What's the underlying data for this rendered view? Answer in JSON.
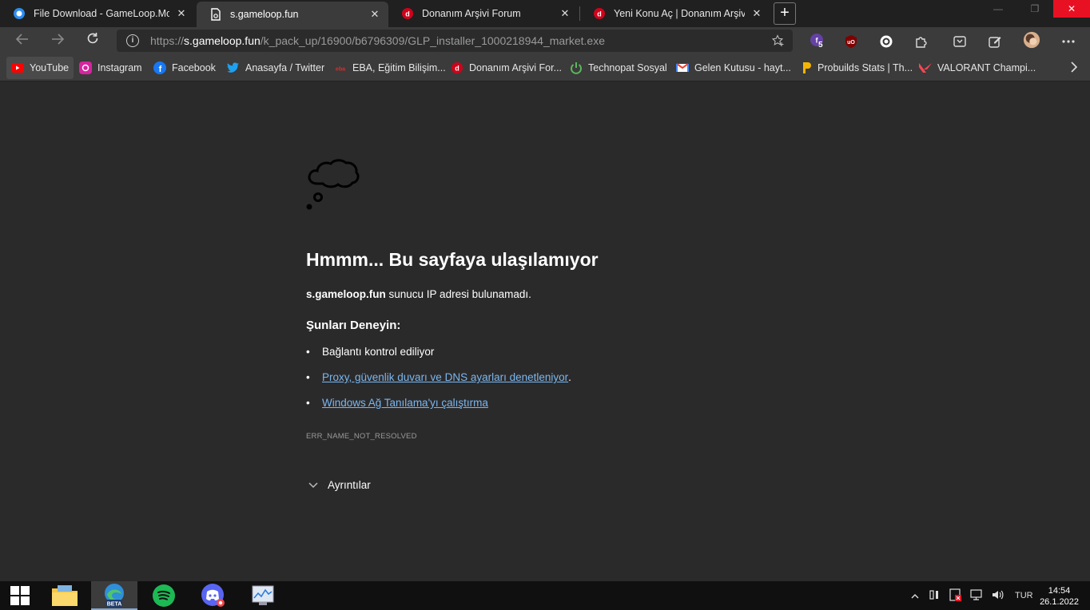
{
  "tabs": [
    {
      "title": "File Download - GameLoop.Mob",
      "icon": "gameloop-icon",
      "active": false
    },
    {
      "title": "s.gameloop.fun",
      "icon": "page-error-icon",
      "active": true
    },
    {
      "title": "Donanım Arşivi Forum",
      "icon": "donanim-arsivi-icon",
      "active": false
    },
    {
      "title": "Yeni Konu Aç | Donanım Arşivi Fo",
      "icon": "donanim-arsivi-icon",
      "active": false
    }
  ],
  "tab_close": "✕",
  "newtab": "+",
  "window_controls": {
    "minimize": "—",
    "maximize": "❐",
    "close": "✕"
  },
  "address": {
    "prefix": "https://",
    "host": "s.gameloop.fun",
    "path": "/k_pack_up/16900/b6796309/GLP_installer_1000218944_market.exe"
  },
  "extensions": {
    "badge_count": "5"
  },
  "bookmarks": [
    {
      "label": "YouTube",
      "icon": "youtube-icon",
      "color": "#ff0000"
    },
    {
      "label": "Instagram",
      "icon": "instagram-icon",
      "color": "#c13584"
    },
    {
      "label": "Facebook",
      "icon": "facebook-icon",
      "color": "#1877f2"
    },
    {
      "label": "Anasayfa / Twitter",
      "icon": "twitter-icon",
      "color": "#1da1f2"
    },
    {
      "label": "EBA, Eğitim Bilişim...",
      "icon": "eba-icon",
      "color": "#d32f2f"
    },
    {
      "label": "Donanım Arşivi For...",
      "icon": "donanim-arsivi-icon",
      "color": "#d0021b"
    },
    {
      "label": "Technopat Sosyal",
      "icon": "technopat-icon",
      "color": "#5cb85c"
    },
    {
      "label": "Gelen Kutusu - hayt...",
      "icon": "gmail-icon",
      "color": "#ea4335"
    },
    {
      "label": "Probuilds Stats | Th...",
      "icon": "probuilds-icon",
      "color": "#f5b400"
    },
    {
      "label": "VALORANT Champi...",
      "icon": "valorant-icon",
      "color": "#ff4655"
    }
  ],
  "error": {
    "title": "Hmmm... Bu sayfaya ulaşılamıyor",
    "host": "s.gameloop.fun",
    "message": " sunucu IP adresi bulunamadı.",
    "try_heading": "Şunları Deneyin:",
    "items": [
      {
        "text": "Bağlantı kontrol ediliyor",
        "link": false,
        "suffix": ""
      },
      {
        "text": "Proxy, güvenlik duvarı ve DNS ayarları denetleniyor",
        "link": true,
        "suffix": "."
      },
      {
        "text": "Windows Ağ Tanılama'yı çalıştırma",
        "link": true,
        "suffix": ""
      }
    ],
    "code": "ERR_NAME_NOT_RESOLVED",
    "details_label": "Ayrıntılar"
  },
  "taskbar": {
    "language": "TUR",
    "time": "14:54",
    "date": "26.1.2022",
    "edge_badge": "BETA"
  }
}
